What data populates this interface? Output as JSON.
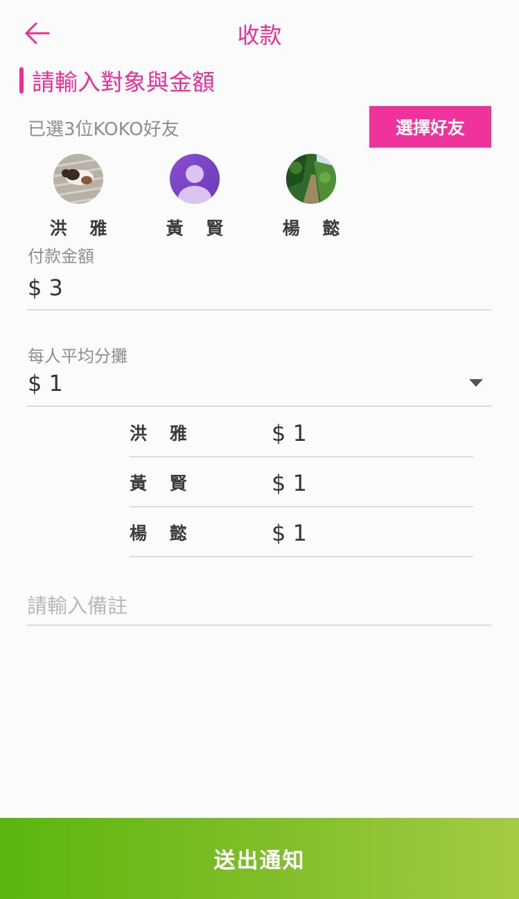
{
  "header": {
    "title": "收款",
    "back_icon": "arrow-left-icon"
  },
  "section_title": "請輸入對象與金額",
  "selected_count": "已選3位KOKO好友",
  "choose_button": "選擇好友",
  "friends": [
    {
      "name": "洪 雅",
      "avatar": "dog-photo"
    },
    {
      "name": "黃 賢",
      "avatar": "default-user-icon"
    },
    {
      "name": "楊 懿",
      "avatar": "forest-photo"
    }
  ],
  "payment": {
    "label": "付款金額",
    "value": "$ 3"
  },
  "split": {
    "label": "每人平均分攤",
    "value": "$ 1",
    "rows": [
      {
        "name": "洪 雅",
        "amount": "$ 1"
      },
      {
        "name": "黃 賢",
        "amount": "$ 1"
      },
      {
        "name": "楊 懿",
        "amount": "$ 1"
      }
    ]
  },
  "note": {
    "placeholder": "請輸入備註",
    "value": ""
  },
  "submit_button": "送出通知",
  "colors": {
    "accent": "#ee2c93",
    "submit_start": "#5bb50e",
    "submit_end": "#a4cb44"
  }
}
